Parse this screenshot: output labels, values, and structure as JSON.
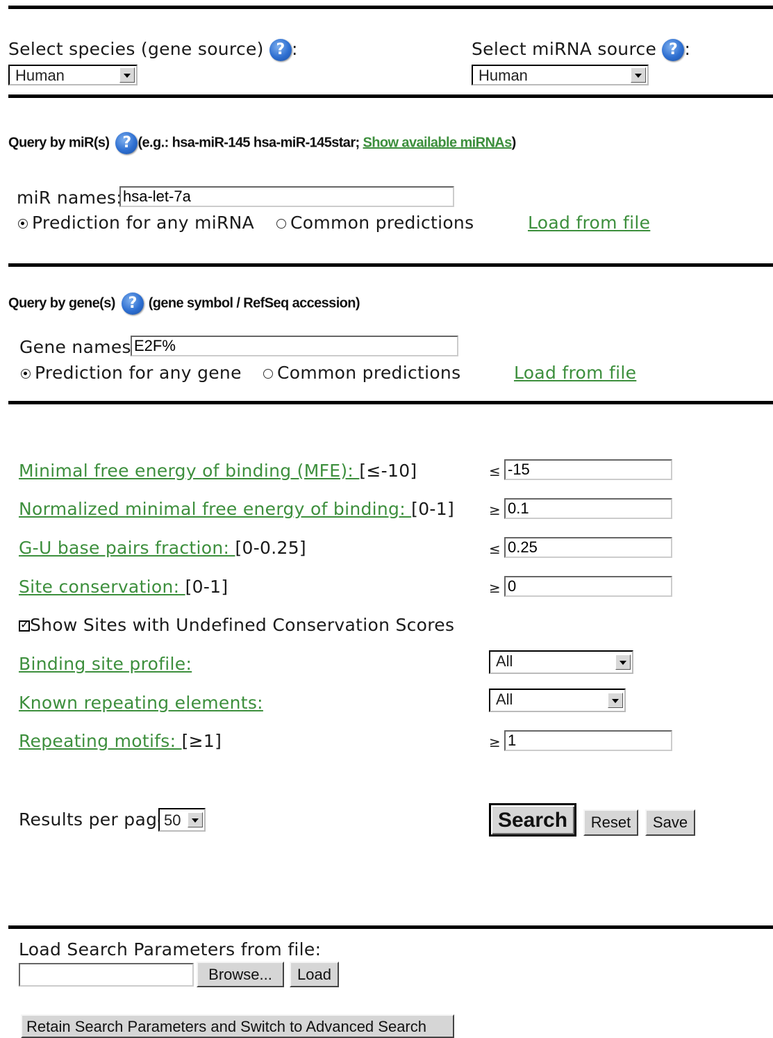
{
  "species": {
    "label": "Select species (gene source)",
    "selected": "Human",
    "colon": ":"
  },
  "mirna_source": {
    "label": "Select miRNA source",
    "selected": "Human",
    "colon": ":"
  },
  "help_glyph": "?",
  "query_mir": {
    "title": "Query by miR(s)",
    "example_prefix": "(e.g.: hsa-miR-145 hsa-miR-145star; ",
    "show_link": "Show available miRNAs",
    "example_suffix": ")",
    "names_label": "miR names:",
    "names_value": "hsa-let-7a",
    "radio_any": "Prediction for any miRNA",
    "radio_common": "Common predictions",
    "load_link": "Load from file"
  },
  "query_gene": {
    "title": "Query by gene(s)",
    "hint": "(gene symbol / RefSeq accession)",
    "names_label": "Gene names:",
    "names_value": "E2F%",
    "radio_any": "Prediction for any gene",
    "radio_common": "Common predictions",
    "load_link": "Load from file"
  },
  "filters": {
    "mfe": {
      "link": "Minimal free energy of binding (MFE): ",
      "range": "[≤-10]",
      "op": "≤",
      "value": "-15"
    },
    "nmfe": {
      "link": "Normalized minimal free energy of binding: ",
      "range": "[0-1]",
      "op": "≥",
      "value": "0.1"
    },
    "gu": {
      "link": "G-U base pairs fraction: ",
      "range": "[0-0.25]",
      "op": "≤",
      "value": "0.25"
    },
    "cons": {
      "link": "Site conservation: ",
      "range": "[0-1]",
      "op": "≥",
      "value": "0"
    },
    "undefined_cons": {
      "label": "Show Sites with Undefined Conservation Scores",
      "checked": true
    },
    "profile": {
      "link": "Binding site profile:",
      "selected": "All"
    },
    "repeats": {
      "link": "Known repeating elements:",
      "selected": "All"
    },
    "motifs": {
      "link": "Repeating motifs: ",
      "range": "[≥1]",
      "op": "≥",
      "value": "1"
    }
  },
  "results": {
    "label": "Results per page",
    "selected": "50"
  },
  "buttons": {
    "search": "Search",
    "reset": "Reset",
    "save": "Save"
  },
  "load_params": {
    "label": "Load Search Parameters from file:",
    "browse": "Browse...",
    "load": "Load",
    "retain": "Retain Search Parameters and Switch to Advanced Search"
  },
  "colors": {
    "link": "#3d8f3d",
    "help_icon": "#2e6fd1"
  }
}
